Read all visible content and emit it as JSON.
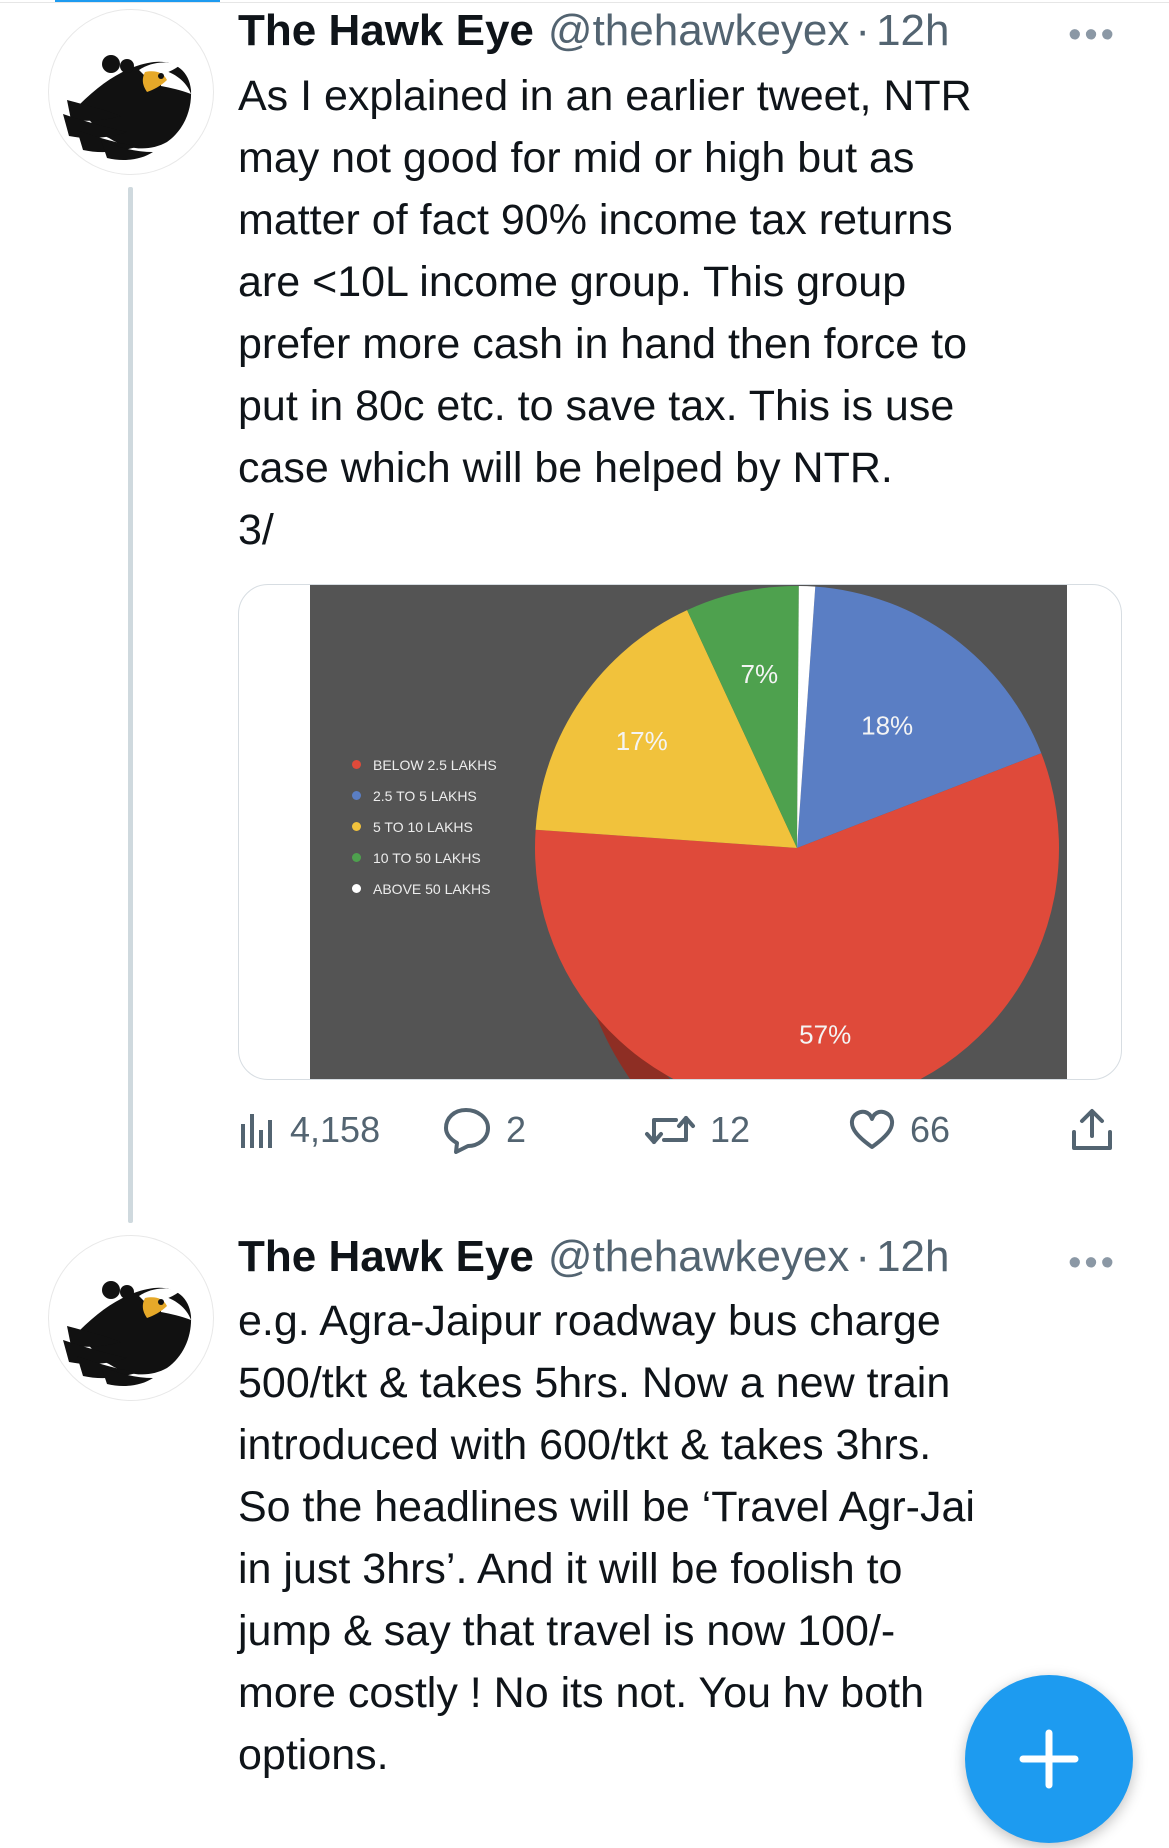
{
  "tweets": [
    {
      "author_name": "The Hawk Eye",
      "handle": "@thehawkeyex",
      "separator": "·",
      "time": "12h",
      "more": "•••",
      "text": "As I explained in an earlier tweet, NTR\nmay not good for mid or high but as\nmatter of fact 90% income tax returns\nare <10L income group. This group\nprefer more cash in hand then force to\nput in 80c etc. to save tax. This is use\ncase which will be helped by NTR.\n3/",
      "stats": {
        "views": "4,158",
        "replies": "2",
        "retweets": "12",
        "likes": "66"
      }
    },
    {
      "author_name": "The Hawk Eye",
      "handle": "@thehawkeyex",
      "separator": "·",
      "time": "12h",
      "more": "•••",
      "text": "e.g. Agra-Jaipur roadway bus charge\n500/tkt & takes 5hrs. Now a new train\nintroduced with 600/tkt & takes 3hrs.\nSo the headlines will be ‘Travel Agr-Jai\nin just 3hrs’. And it will be foolish to\njump & say that travel is now 100/-\nmore costly ! No its not. You hv both\noptions."
    }
  ],
  "chart_data": {
    "type": "pie",
    "title": "",
    "categories": [
      "BELOW 2.5 LAKHS",
      "2.5 TO 5 LAKHS",
      "5 TO 10 LAKHS",
      "10 TO 50 LAKHS",
      "ABOVE 50 LAKHS"
    ],
    "values": [
      57,
      18,
      17,
      7,
      1
    ],
    "labels": [
      "57%",
      "18%",
      "17%",
      "7%",
      "1%"
    ],
    "colors": [
      "#df4a3a",
      "#5a7ec4",
      "#f1c23c",
      "#4ea14e",
      "#ffffff"
    ],
    "background": "#545454",
    "legend": "left"
  },
  "icons": {
    "views": "bar-chart-icon",
    "replies": "comment-bubble-icon",
    "retweets": "retweet-icon",
    "likes": "heart-icon",
    "share": "share-icon",
    "compose": "plus-icon"
  },
  "colors": {
    "accent": "#1d9bf0",
    "secondary_text": "#536471",
    "thread_line": "#cfd9de"
  }
}
